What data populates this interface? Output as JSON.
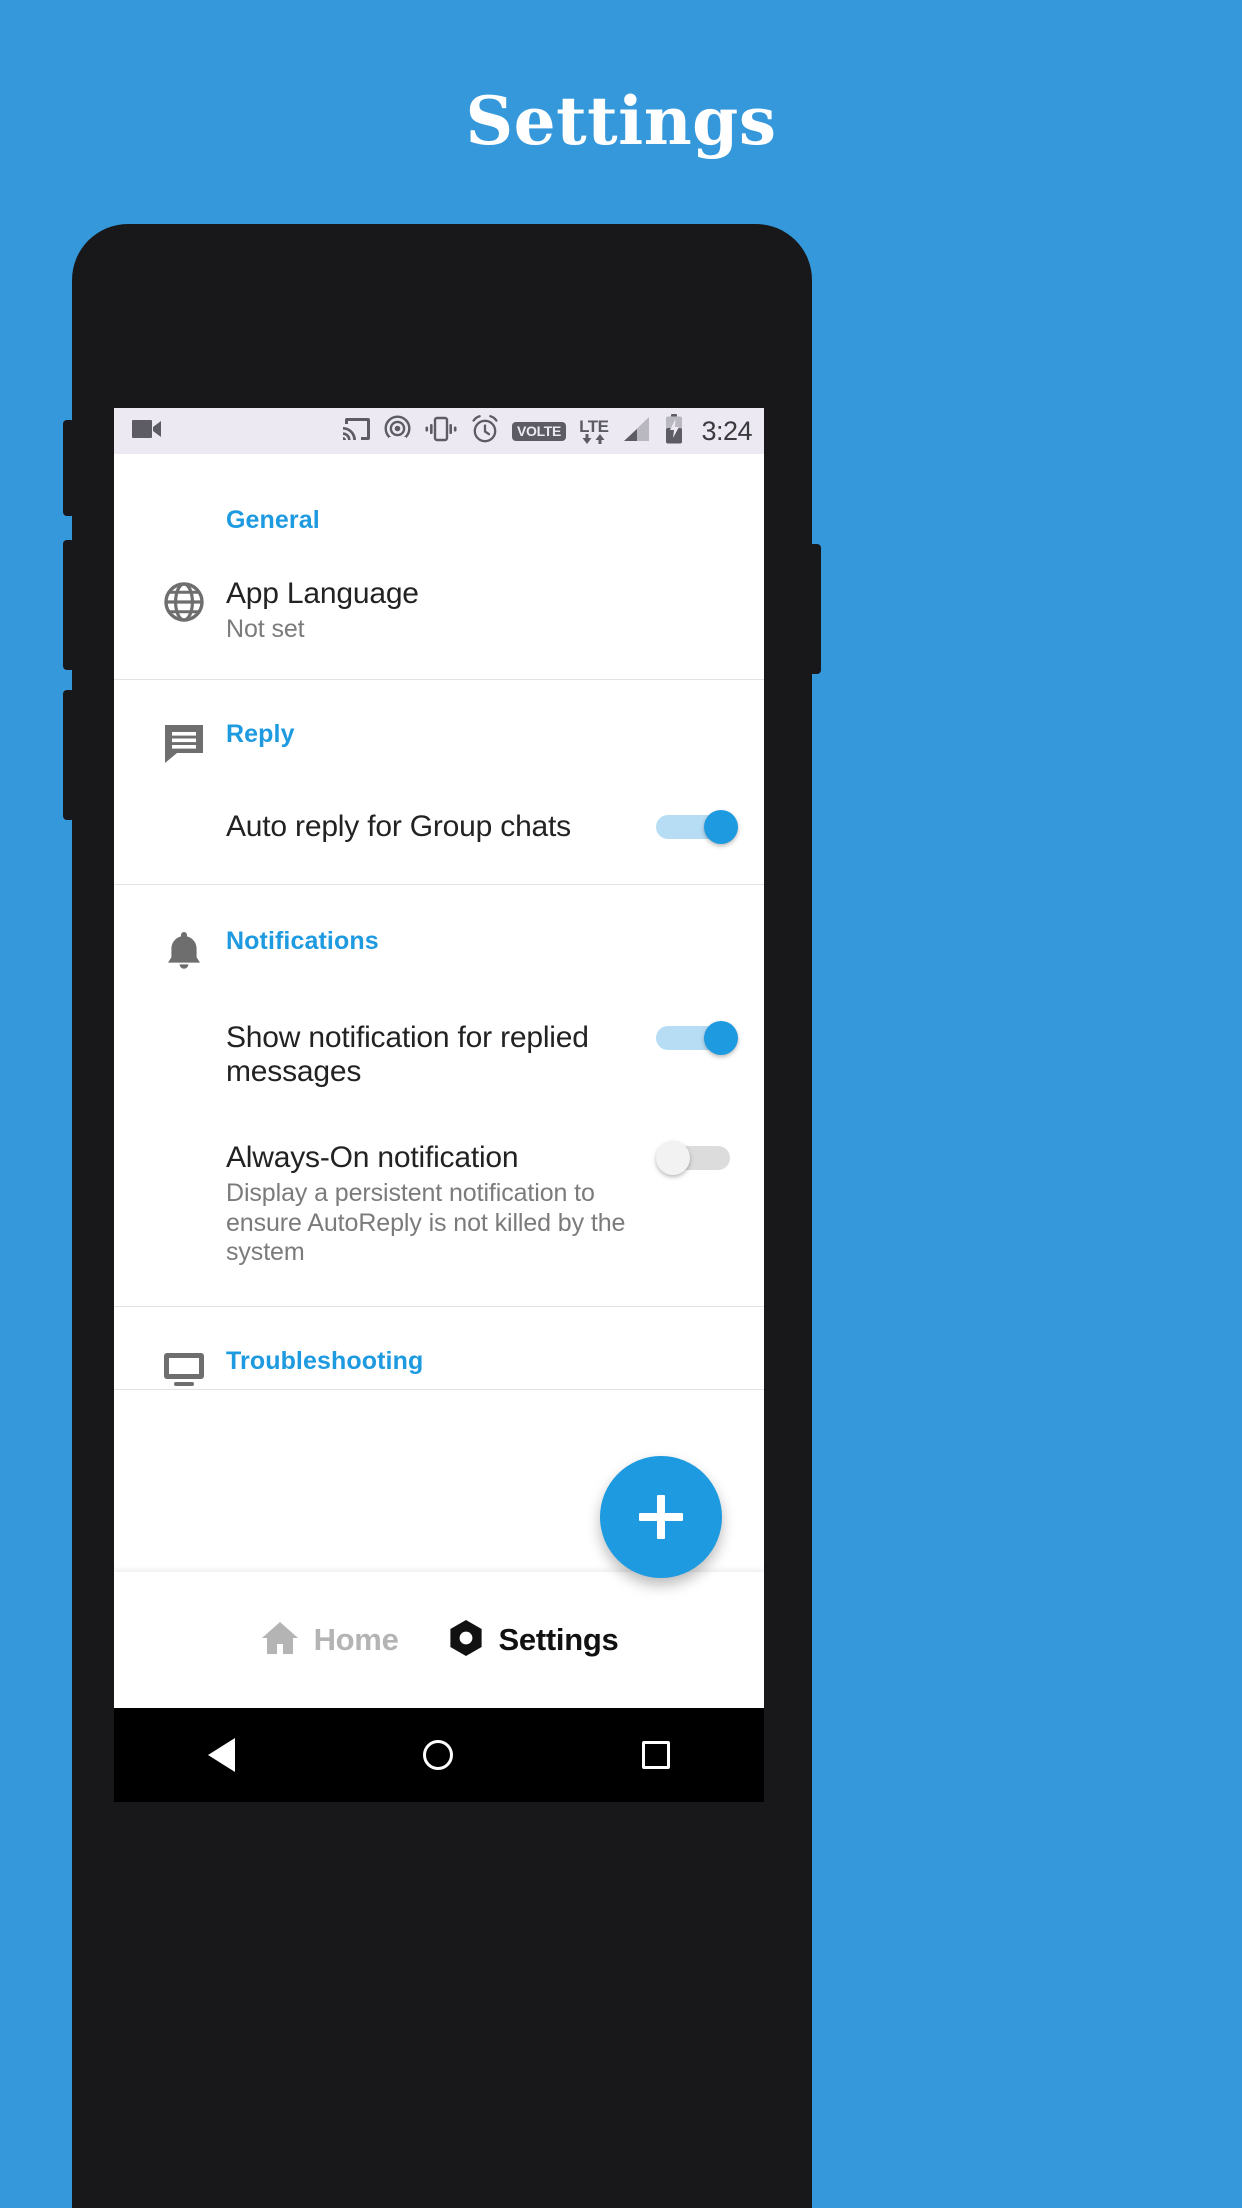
{
  "promo": {
    "title": "Settings",
    "background_color": "#3498db"
  },
  "statusbar": {
    "time": "3:24",
    "volte_label": "VOLTE",
    "network_label": "LTE",
    "icons": [
      "video-camera-icon",
      "cast-icon",
      "hotspot-icon",
      "vibrate-icon",
      "alarm-icon",
      "volte-badge",
      "lte-icon",
      "signal-icon",
      "battery-charging-icon"
    ]
  },
  "settings": {
    "accent_color": "#1e9ae0",
    "sections": [
      {
        "key": "general",
        "header": "General",
        "icon": "globe-icon",
        "items": [
          {
            "title": "App Language",
            "subtitle": "Not set",
            "icon": "globe-icon",
            "control": "none"
          }
        ]
      },
      {
        "key": "reply",
        "header": "Reply",
        "icon": "chat-bubble-icon",
        "items": [
          {
            "title": "Auto reply for Group chats",
            "subtitle": "",
            "control": "toggle",
            "toggle_state": "on"
          }
        ]
      },
      {
        "key": "notifications",
        "header": "Notifications",
        "icon": "bell-icon",
        "items": [
          {
            "title": "Show notification for replied messages",
            "subtitle": "",
            "control": "toggle",
            "toggle_state": "on"
          },
          {
            "title": "Always-On notification",
            "subtitle": "Display a persistent notification to ensure AutoReply is not killed by the system",
            "control": "toggle",
            "toggle_state": "off"
          }
        ]
      },
      {
        "key": "troubleshooting",
        "header": "Troubleshooting",
        "icon": "device-icon",
        "items": []
      }
    ]
  },
  "fab": {
    "icon": "plus-icon",
    "label": "+",
    "color": "#1e9ae0"
  },
  "bottom_nav": {
    "items": [
      {
        "label": "Home",
        "icon": "home-icon",
        "active": false
      },
      {
        "label": "Settings",
        "icon": "gear-icon",
        "active": true
      }
    ]
  },
  "android_nav": {
    "back": "back-triangle-icon",
    "home": "home-circle-icon",
    "recents": "recents-square-icon"
  }
}
